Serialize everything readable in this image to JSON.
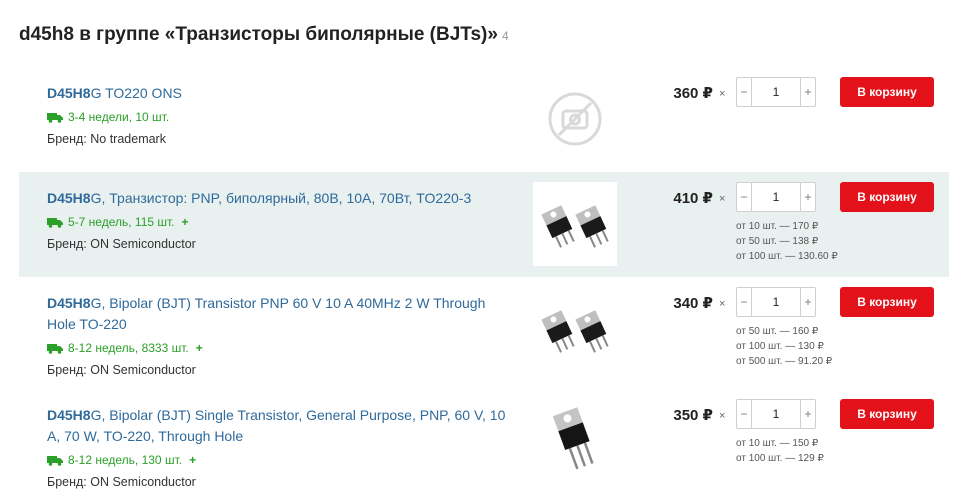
{
  "heading": {
    "query": "d45h8",
    "text": "d45h8 в группе «Транзисторы биполярные (BJTs)»",
    "count": "4"
  },
  "products": [
    {
      "title_bold": "D45H8",
      "title_rest": "G TO220 ONS",
      "stock": "3-4 недели, 10 шт.",
      "brand": "Бренд: No trademark",
      "price": "360 ₽",
      "qty": "1",
      "cart_label": "В корзину",
      "tiers": []
    },
    {
      "title_bold": "D45H8",
      "title_rest": "G, Транзистор: PNP, биполярный, 80В, 10А, 70Вт, TO220-3",
      "stock": "5-7 недель, 115 шт.",
      "brand": "Бренд: ON Semiconductor",
      "price": "410 ₽",
      "qty": "1",
      "cart_label": "В корзину",
      "tiers": [
        "от 10 шт. — 170 ₽",
        "от 50 шт. — 138 ₽",
        "от 100 шт. — 130.60 ₽"
      ]
    },
    {
      "title_bold": "D45H8",
      "title_rest": "G, Bipolar (BJT) Transistor PNP 60 V 10 A 40MHz 2 W Through Hole TO-220",
      "stock": "8-12 недель, 8333 шт.",
      "brand": "Бренд: ON Semiconductor",
      "price": "340 ₽",
      "qty": "1",
      "cart_label": "В корзину",
      "tiers": [
        "от 50 шт. — 160 ₽",
        "от 100 шт. — 130 ₽",
        "от 500 шт. — 91.20 ₽"
      ]
    },
    {
      "title_bold": "D45H8",
      "title_rest": "G, Bipolar (BJT) Single Transistor, General Purpose, PNP, 60 V, 10 A, 70 W, TO-220, Through Hole",
      "stock": "8-12 недель, 130 шт.",
      "brand": "Бренд: ON Semiconductor",
      "price": "350 ₽",
      "qty": "1",
      "cart_label": "В корзину",
      "tiers": [
        "от 10 шт. — 150 ₽",
        "от 100 шт. — 129 ₽"
      ]
    }
  ],
  "symbols": {
    "times": "×",
    "minus": "−",
    "plus": "+",
    "stock_plus": "+"
  },
  "icons": {
    "truck": "truck-icon",
    "no_photo": "no-photo-icon"
  },
  "colors": {
    "link": "#2f6a9a",
    "stock": "#2aa02a",
    "cart": "#e3111a",
    "alt_row": "#e9f0f0"
  }
}
